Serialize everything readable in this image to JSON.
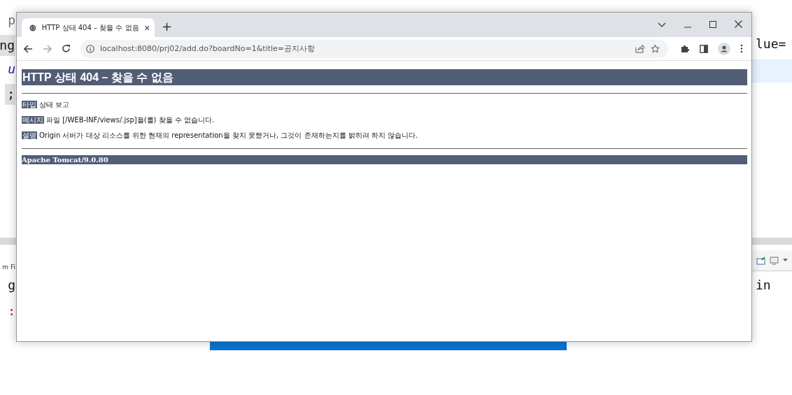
{
  "background": {
    "fragments": [
      {
        "text": "p",
        "kind": "faded"
      },
      {
        "text": "ng",
        "kind": "shaded"
      },
      {
        "text": "lue=",
        "kind": "plain"
      },
      {
        "text": "u",
        "kind": "italic"
      },
      {
        "text": ";",
        "kind": "shaded"
      },
      {
        "text": "m Fi",
        "kind": "small"
      },
      {
        "text": "g",
        "kind": "plain"
      },
      {
        "text": "in",
        "kind": "plain"
      },
      {
        "text": ":",
        "kind": "error"
      }
    ]
  },
  "browser": {
    "tabs": [
      {
        "title": "HTTP 상태 404 – 찾을 수 없음",
        "selected": true
      }
    ],
    "new_tab": "+",
    "address": "localhost:8080/prj02/add.do?boardNo=1&title=공지사항",
    "page": {
      "heading": "HTTP 상태 404 – 찾을 수 없음",
      "fields": [
        {
          "label": "타입",
          "value": "상태 보고"
        },
        {
          "label": "메시지",
          "value": "파일 [/WEB-INF/views/.jsp]을(를) 찾을 수 없습니다."
        },
        {
          "label": "설명",
          "value": "Origin 서버가 대상 리소스를 위한 현재의 representation을 찾지 못했거나, 그것이 존재하는지를 밝히려 하지 않습니다."
        }
      ],
      "footer": "Apache Tomcat/9.0.80"
    }
  }
}
